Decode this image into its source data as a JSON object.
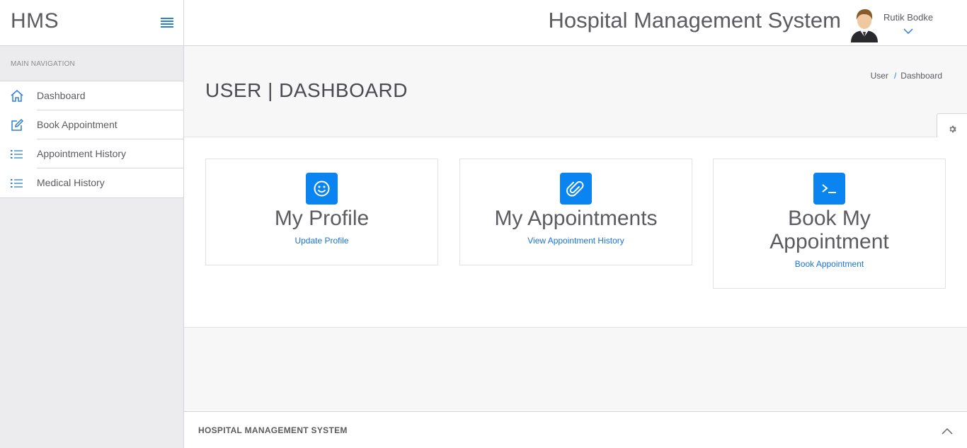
{
  "sidebar": {
    "brand": "HMS",
    "section_heading": "MAIN NAVIGATION",
    "items": [
      {
        "label": "Dashboard",
        "icon": "home-icon"
      },
      {
        "label": "Book Appointment",
        "icon": "edit-icon"
      },
      {
        "label": "Appointment History",
        "icon": "list-icon"
      },
      {
        "label": "Medical History",
        "icon": "list-icon"
      }
    ]
  },
  "header": {
    "title": "Hospital Management System",
    "user_name": "Rutik Bodke"
  },
  "page": {
    "title": "USER | DASHBOARD",
    "breadcrumb": [
      "User",
      "Dashboard"
    ]
  },
  "cards": [
    {
      "title": "My Profile",
      "link": "Update Profile",
      "icon": "smile-icon"
    },
    {
      "title": "My Appointments",
      "link": "View Appointment History",
      "icon": "paperclip-icon"
    },
    {
      "title": "Book My Appointment",
      "link": "Book Appointment",
      "icon": "terminal-icon"
    }
  ],
  "footer": {
    "text": "HOSPITAL MANAGEMENT SYSTEM"
  },
  "colors": {
    "accent": "#0a84f0",
    "link": "#1a73d6",
    "sidebar_bg": "#ececef"
  }
}
